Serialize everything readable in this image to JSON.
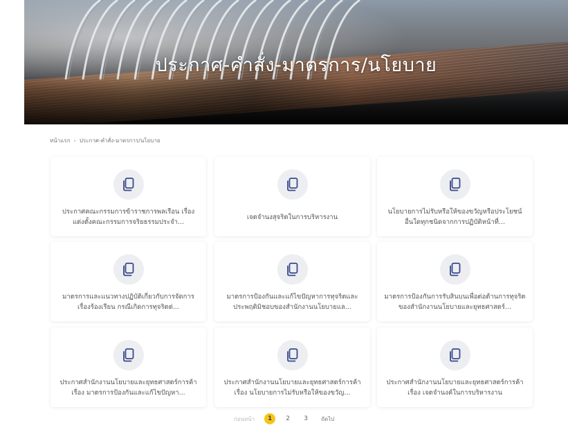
{
  "hero": {
    "title": "ประกาศ-คำสั่ง-มาตรการ/นโยบาย"
  },
  "breadcrumb": {
    "home": "หน้าแรก",
    "current": "ประกาศ-คำสั่ง-มาตรการ/นโยบาย"
  },
  "cards": [
    {
      "icon": "document-icon",
      "title": "ประกาศคณะกรรมการข้าราชการพลเรือน เรื่อง แต่งตั้งคณะกรรมการจริยธรรมประจำ..."
    },
    {
      "icon": "document-icon",
      "title": "เจตจำนงสุจริตในการบริหารงาน"
    },
    {
      "icon": "document-icon",
      "title": "นโยบายการไม่รับหรือให้ของขวัญหรือประโยชน์อื่นใดทุกชนิดจากการปฏิบัติหน้าที่..."
    },
    {
      "icon": "document-icon",
      "title": "มาตรการและแนวทางปฏิบัติเกี่ยวกับการจัดการเรื่องร้องเรียน กรณีเกิดการทุจริตต่..."
    },
    {
      "icon": "document-icon",
      "title": "มาตรการป้องกันและแก้ไขปัญหาการทุจริตและประพฤติมิชอบของสำนักงานนโยบายแล..."
    },
    {
      "icon": "document-icon",
      "title": "มาตรการป้องกันการรับสินบนเพื่อต่อต้านการทุจริตของสำนักงานนโยบายและยุทธศาสตร์..."
    },
    {
      "icon": "document-icon",
      "title": "ประกาศสำนักงานนโยบายและยุทธศาสตร์การค้า เรื่อง มาตรการป้องกันและแก้ไขปัญหา..."
    },
    {
      "icon": "document-icon",
      "title": "ประกาศสำนักงานนโยบายและยุทธศาสตร์การค้า เรื่อง นโยบายการไม่รับหรือให้ของขวัญ..."
    },
    {
      "icon": "document-icon",
      "title": "ประกาศสำนักงานนโยบายและยุทธศาสตร์การค้า เรื่อง เจตจำนงค์ในการบริหารงาน"
    }
  ],
  "pagination": {
    "prev": "ก่อนหน้า",
    "pages": [
      "1",
      "2",
      "3"
    ],
    "current": "1",
    "next": "ถัดไป"
  },
  "colors": {
    "accent": "#f5c518",
    "icon_bg": "#eceef1",
    "icon_stroke": "#3a4a8a"
  }
}
